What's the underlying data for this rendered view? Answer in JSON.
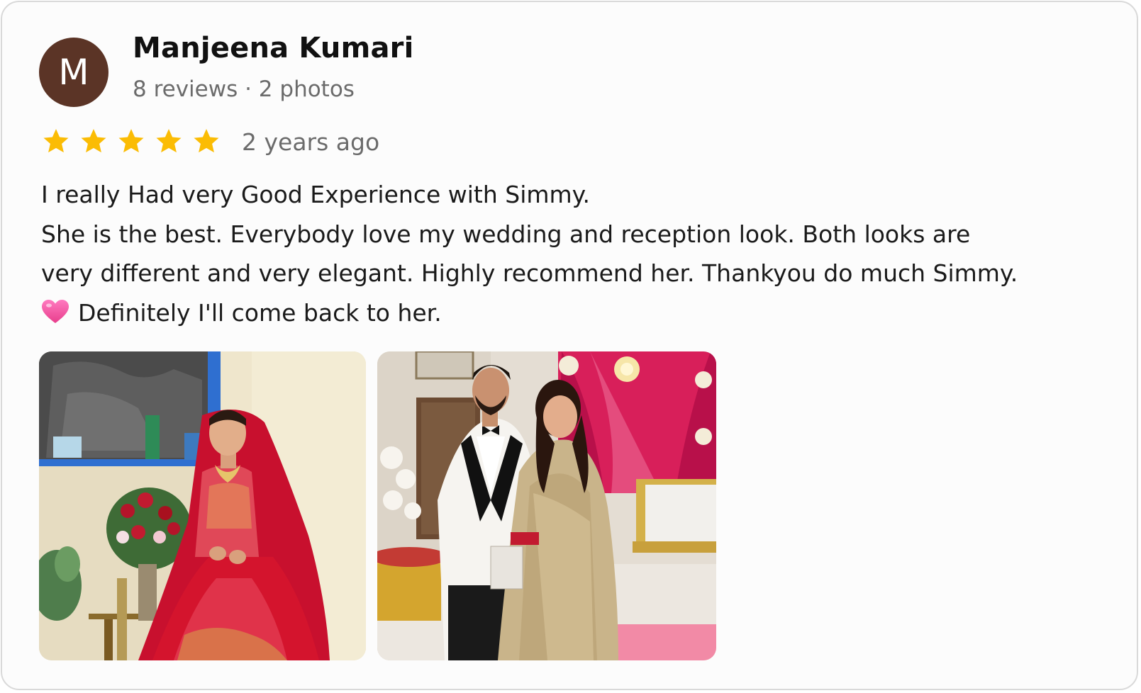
{
  "reviewer": {
    "initial": "M",
    "name": "Manjeena Kumari",
    "meta": "8 reviews · 2 photos",
    "avatar_color": "#5b3426"
  },
  "rating": {
    "stars": 5,
    "max": 5,
    "star_color": "#fbbc04",
    "time": "2 years ago"
  },
  "review": {
    "lines": [
      "I really Had very Good Experience with Simmy.",
      "She is the best. Everybody love my wedding and reception look. Both looks are",
      "very different and very elegant. Highly recommend her. Thankyou do much Simmy.",
      "Definitely I'll come back to her."
    ],
    "emoji": "pink-heart-icon"
  },
  "photos": [
    {
      "name": "review-photo-bride-red-lehenga"
    },
    {
      "name": "review-photo-couple-reception"
    }
  ]
}
